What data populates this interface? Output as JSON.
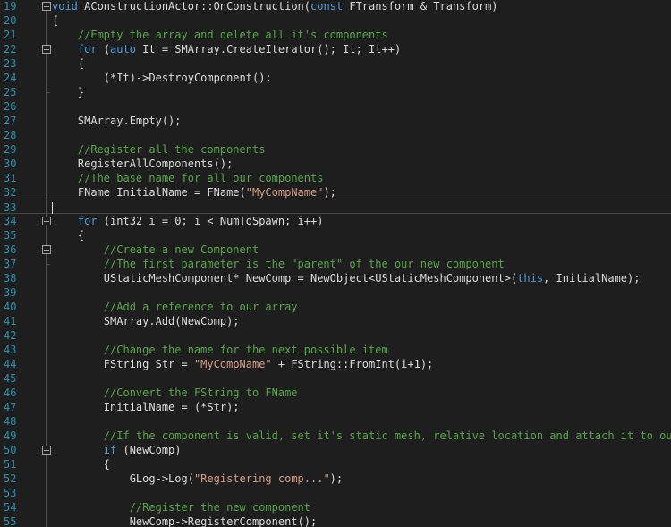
{
  "editor": {
    "lines": [
      {
        "n": "19",
        "fold": "open",
        "t": [
          [
            "kw",
            "void"
          ],
          [
            "tx",
            " AConstructionActor::OnConstruction("
          ],
          [
            "kw",
            "const"
          ],
          [
            "tx",
            " FTransform & Transform)"
          ]
        ]
      },
      {
        "n": "20",
        "t": [
          [
            "tx",
            "{"
          ]
        ]
      },
      {
        "n": "21",
        "t": [
          [
            "tx",
            "    "
          ],
          [
            "cm",
            "//Empty the array and delete all it's components"
          ]
        ]
      },
      {
        "n": "22",
        "fold": "open",
        "t": [
          [
            "tx",
            "    "
          ],
          [
            "kw",
            "for"
          ],
          [
            "tx",
            " ("
          ],
          [
            "kw",
            "auto"
          ],
          [
            "tx",
            " It = SMArray.CreateIterator(); It; It++)"
          ]
        ]
      },
      {
        "n": "23",
        "t": [
          [
            "tx",
            "    {"
          ]
        ]
      },
      {
        "n": "24",
        "t": [
          [
            "tx",
            "        (*It)->DestroyComponent();"
          ]
        ]
      },
      {
        "n": "25",
        "t": [
          [
            "tx",
            "    }"
          ]
        ]
      },
      {
        "n": "26",
        "t": []
      },
      {
        "n": "27",
        "t": [
          [
            "tx",
            "    SMArray.Empty();"
          ]
        ]
      },
      {
        "n": "28",
        "t": []
      },
      {
        "n": "29",
        "t": [
          [
            "tx",
            "    "
          ],
          [
            "cm",
            "//Register all the components"
          ]
        ]
      },
      {
        "n": "30",
        "t": [
          [
            "tx",
            "    RegisterAllComponents();"
          ]
        ]
      },
      {
        "n": "31",
        "t": [
          [
            "tx",
            "    "
          ],
          [
            "cm",
            "//The base name for all our components"
          ]
        ]
      },
      {
        "n": "32",
        "t": [
          [
            "tx",
            "    FName InitialName = FName("
          ],
          [
            "str",
            "\"MyCompName\""
          ],
          [
            "tx",
            ");"
          ]
        ]
      },
      {
        "n": "33",
        "current": true,
        "t": []
      },
      {
        "n": "34",
        "fold": "open",
        "t": [
          [
            "tx",
            "    "
          ],
          [
            "kw",
            "for"
          ],
          [
            "tx",
            " (int32 i = 0; i < NumToSpawn; i++)"
          ]
        ]
      },
      {
        "n": "35",
        "t": [
          [
            "tx",
            "    {"
          ]
        ]
      },
      {
        "n": "36",
        "fold": "open",
        "t": [
          [
            "tx",
            "        "
          ],
          [
            "cm",
            "//Create a new Component"
          ]
        ]
      },
      {
        "n": "37",
        "t": [
          [
            "tx",
            "        "
          ],
          [
            "cm",
            "//The first parameter is the \"parent\" of the our new component"
          ]
        ]
      },
      {
        "n": "38",
        "t": [
          [
            "tx",
            "        UStaticMeshComponent* NewComp = NewObject<UStaticMeshComponent>("
          ],
          [
            "kw",
            "this"
          ],
          [
            "tx",
            ", InitialName);"
          ]
        ]
      },
      {
        "n": "39",
        "t": []
      },
      {
        "n": "40",
        "t": [
          [
            "tx",
            "        "
          ],
          [
            "cm",
            "//Add a reference to our array"
          ]
        ]
      },
      {
        "n": "41",
        "t": [
          [
            "tx",
            "        SMArray.Add(NewComp);"
          ]
        ]
      },
      {
        "n": "42",
        "t": []
      },
      {
        "n": "43",
        "t": [
          [
            "tx",
            "        "
          ],
          [
            "cm",
            "//Change the name for the next possible item"
          ]
        ]
      },
      {
        "n": "44",
        "t": [
          [
            "tx",
            "        FString Str = "
          ],
          [
            "str",
            "\"MyCompName\""
          ],
          [
            "tx",
            " + FString::FromInt(i+1);"
          ]
        ]
      },
      {
        "n": "45",
        "t": []
      },
      {
        "n": "46",
        "t": [
          [
            "tx",
            "        "
          ],
          [
            "cm",
            "//Convert the FString to FName"
          ]
        ]
      },
      {
        "n": "47",
        "t": [
          [
            "tx",
            "        InitialName = (*Str);"
          ]
        ]
      },
      {
        "n": "48",
        "t": []
      },
      {
        "n": "49",
        "t": [
          [
            "tx",
            "        "
          ],
          [
            "cm",
            "//If the component is valid, set it's static mesh, relative location and attach it to our p"
          ]
        ]
      },
      {
        "n": "50",
        "fold": "open",
        "t": [
          [
            "tx",
            "        "
          ],
          [
            "kw",
            "if"
          ],
          [
            "tx",
            " (NewComp)"
          ]
        ]
      },
      {
        "n": "51",
        "t": [
          [
            "tx",
            "        {"
          ]
        ]
      },
      {
        "n": "52",
        "t": [
          [
            "tx",
            "            GLog->Log("
          ],
          [
            "str",
            "\"Registering comp...\""
          ],
          [
            "tx",
            ");"
          ]
        ]
      },
      {
        "n": "53",
        "t": []
      },
      {
        "n": "54",
        "t": [
          [
            "tx",
            "            "
          ],
          [
            "cm",
            "//Register the new component"
          ]
        ]
      },
      {
        "n": "55",
        "t": [
          [
            "tx",
            "            NewComp->RegisterComponent();"
          ]
        ]
      }
    ]
  }
}
